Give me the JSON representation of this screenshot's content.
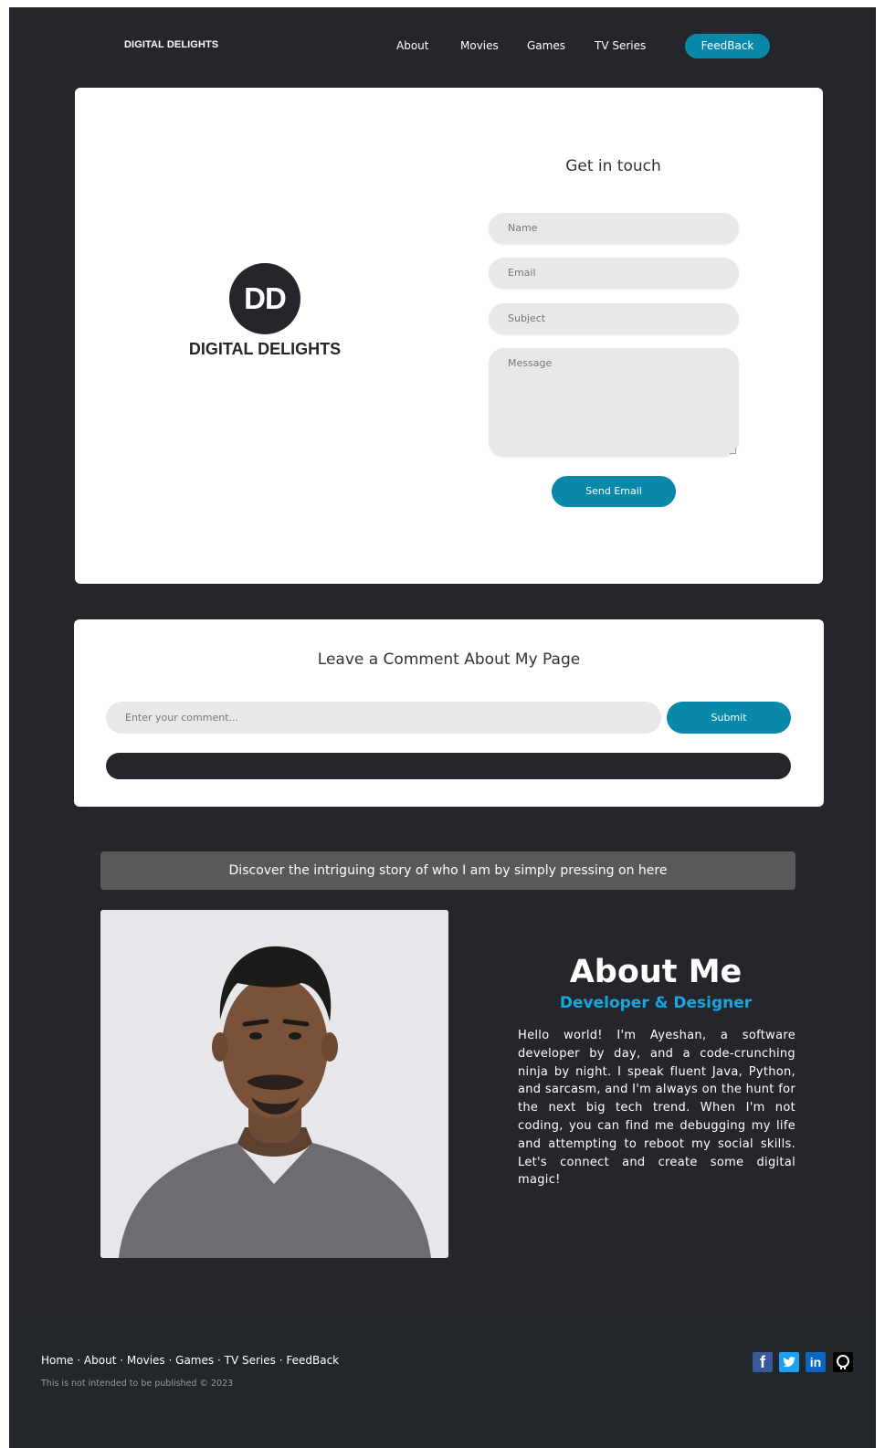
{
  "nav": {
    "brand": "DIGITAL DELIGHTS",
    "links": [
      "About",
      "Movies",
      "Games",
      "TV Series"
    ],
    "feedback_label": "FeedBack"
  },
  "contact": {
    "logo_initials": "DD",
    "logo_text": "DIGITAL DELIGHTS",
    "title": "Get in touch",
    "name_placeholder": "Name",
    "email_placeholder": "Email",
    "subject_placeholder": "Subject",
    "message_placeholder": "Message",
    "send_label": "Send Email"
  },
  "comment": {
    "title": "Leave a Comment About My Page",
    "input_placeholder": "Enter your comment...",
    "submit_label": "Submit"
  },
  "discover": {
    "label": "Discover the intriguing story of who I am by simply pressing on here"
  },
  "about": {
    "title": "About Me",
    "subtitle": "Developer & Designer",
    "body": "Hello world! I'm Ayeshan, a software developer by day, and a code-crunching ninja by night. I speak fluent Java, Python, and sarcasm, and I'm always on the hunt for the next big tech trend. When I'm not coding, you can find me debugging my life and attempting to reboot my social skills. Let's connect and create some digital magic!"
  },
  "footer": {
    "links": [
      "Home",
      "About",
      "Movies",
      "Games",
      "TV Series",
      "FeedBack"
    ],
    "separator": "·",
    "note": "This is not intended to be published © 2023",
    "social": [
      {
        "icon": "facebook-icon",
        "glyph": "f",
        "color": "#3b5998"
      },
      {
        "icon": "twitter-icon",
        "glyph": "t",
        "color": "#1da1f2"
      },
      {
        "icon": "linkedin-icon",
        "glyph": "in",
        "color": "#0a66c2"
      },
      {
        "icon": "github-icon",
        "glyph": "gh",
        "color": "#000000"
      }
    ]
  },
  "colors": {
    "background": "#25262c",
    "accent": "#0a88a9",
    "subtitle": "#15a8e0",
    "discover_bar": "#59595b"
  }
}
